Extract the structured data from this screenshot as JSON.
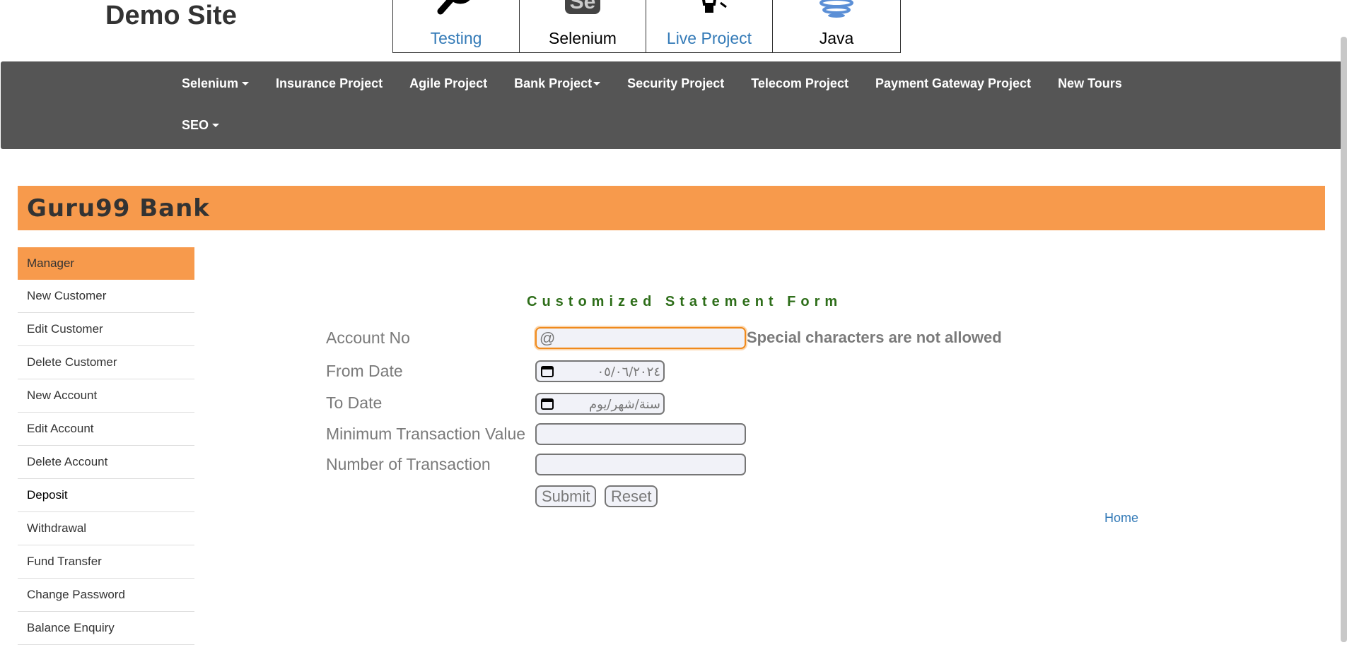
{
  "site": {
    "title": "Demo Site"
  },
  "top_tabs": [
    {
      "label": "Testing",
      "icon": "magnifier-icon"
    },
    {
      "label": "Selenium",
      "icon": "selenium-logo-icon"
    },
    {
      "label": "Live Project",
      "icon": "lightbulb-icon"
    },
    {
      "label": "Java",
      "icon": "java-cup-icon"
    }
  ],
  "navbar": {
    "items": [
      "Selenium",
      "Insurance Project",
      "Agile Project",
      "Bank Project",
      "Security Project",
      "Telecom Project",
      "Payment Gateway Project",
      "New Tours",
      "SEO"
    ]
  },
  "bank": {
    "name": "Guru99 Bank"
  },
  "sidebar": {
    "items": [
      "Manager",
      "New Customer",
      "Edit Customer",
      "Delete Customer",
      "New Account",
      "Edit Account",
      "Delete Account",
      "Deposit",
      "Withdrawal",
      "Fund Transfer",
      "Change Password",
      "Balance Enquiry"
    ]
  },
  "form": {
    "title": "Customized Statement Form",
    "account_no_label": "Account No",
    "account_no_value": "@",
    "account_no_error": "Special characters are not allowed",
    "from_date_label": "From Date",
    "from_date_value": "٠٥/٠٦/٢٠٢٤",
    "to_date_label": "To Date",
    "to_date_value": "سنة/شهر/يوم",
    "min_value_label": "Minimum Transaction Value",
    "num_tx_label": "Number of Transaction",
    "submit_label": "Submit",
    "reset_label": "Reset",
    "home_link": "Home"
  },
  "colors": {
    "navbar": "#555555",
    "accent_orange": "#f79a4c",
    "form_title_green": "#2e6e1a",
    "link_blue": "#337ab7"
  }
}
